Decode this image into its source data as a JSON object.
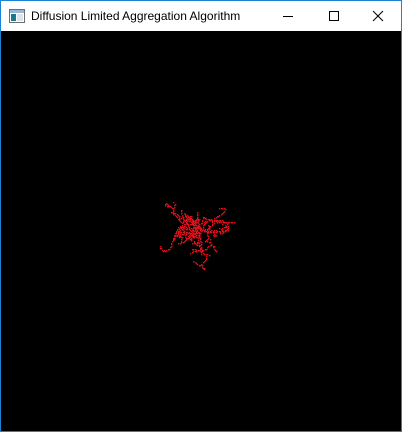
{
  "window": {
    "title": "Diffusion Limited Aggregation Algorithm",
    "accent_color": "#1883d7"
  },
  "titlebar": {
    "app_icon": "window-app-icon",
    "buttons": [
      {
        "name": "minimize",
        "icon": "minimize-icon"
      },
      {
        "name": "maximize",
        "icon": "maximize-icon"
      },
      {
        "name": "close",
        "icon": "close-icon"
      }
    ]
  },
  "canvas": {
    "background": "#000000",
    "particle_color": "#e0101a"
  }
}
